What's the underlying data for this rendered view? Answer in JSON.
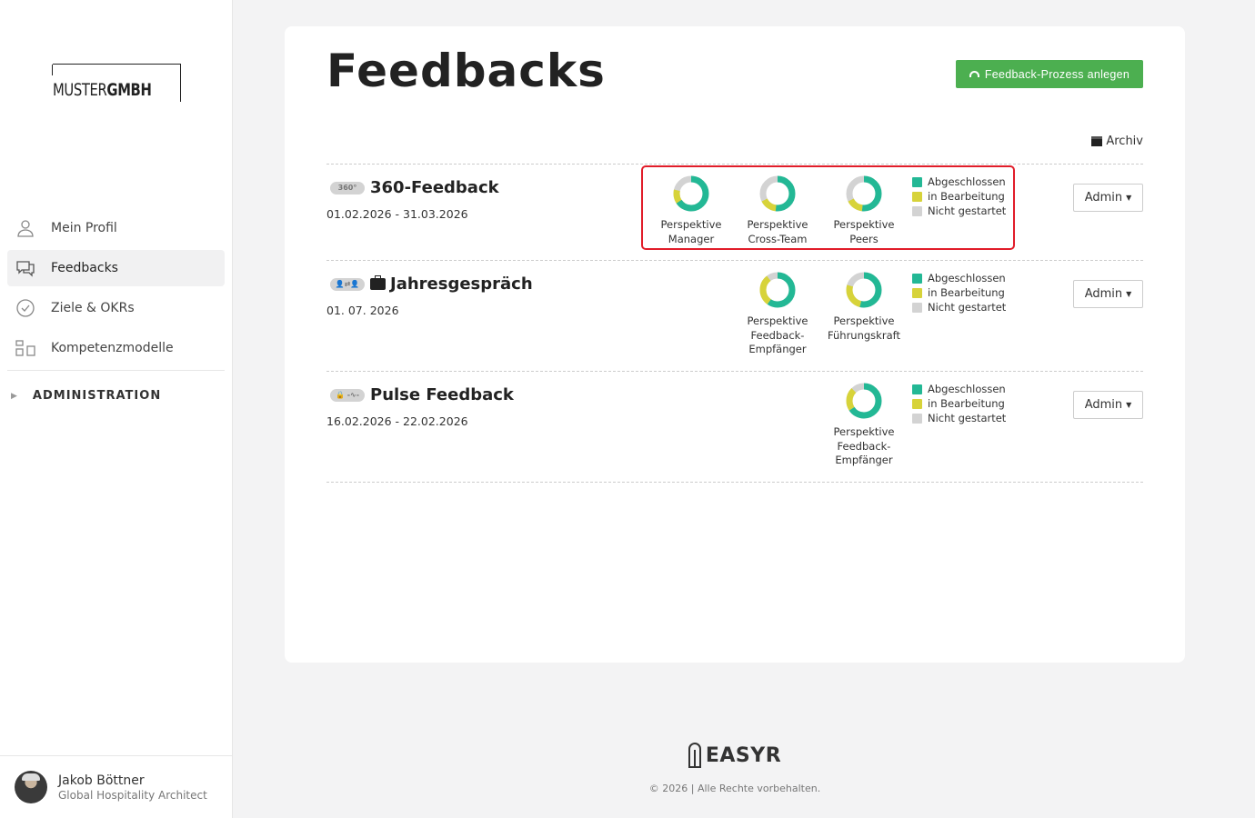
{
  "sidebar": {
    "logo": {
      "part1": "MUSTER",
      "part2": "GMBH"
    },
    "nav": [
      {
        "label": "Mein Profil",
        "icon": "user-icon"
      },
      {
        "label": "Feedbacks",
        "icon": "chat-icon"
      },
      {
        "label": "Ziele & OKRs",
        "icon": "check-circle-icon"
      },
      {
        "label": "Kompetenzmodelle",
        "icon": "model-icon"
      }
    ],
    "admin_label": "ADMINISTRATION",
    "user": {
      "name": "Jakob Böttner",
      "role": "Global Hospitality Architect"
    }
  },
  "main": {
    "title": "Feedbacks",
    "create_button": "Feedback-Prozess anlegen",
    "archive_label": "Archiv",
    "feedbacks": [
      {
        "title": "360-Feedback",
        "type_icon": "360°",
        "date": "01.02.2026 - 31.03.2026",
        "admin": "Admin",
        "perspectives": [
          {
            "label1": "Perspektive",
            "label2": "Manager",
            "label3": ""
          },
          {
            "label1": "Perspektive",
            "label2": "Cross-Team",
            "label3": ""
          },
          {
            "label1": "Perspektive",
            "label2": "Peers",
            "label3": ""
          }
        ]
      },
      {
        "title": "Jahresgespräch",
        "type_icon": "👤⇄👤",
        "date": "01. 07. 2026",
        "admin": "Admin",
        "perspectives": [
          {
            "label1": "Perspektive",
            "label2": "Feedback-",
            "label3": "Empfänger"
          },
          {
            "label1": "Perspektive",
            "label2": "Führungskraft",
            "label3": ""
          }
        ]
      },
      {
        "title": "Pulse Feedback",
        "type_icon": "🔒 -∿-",
        "date": "16.02.2026 - 22.02.2026",
        "admin": "Admin",
        "perspectives": [
          {
            "label1": "Perspektive",
            "label2": "Feedback-",
            "label3": "Empfänger"
          }
        ]
      }
    ],
    "legend": {
      "done": "Abgeschlossen",
      "in_progress": "in Bearbeitung",
      "not_started": "Nicht gestartet"
    }
  },
  "colors": {
    "done": "#23b895",
    "in_progress": "#d7d33a",
    "not_started": "#d3d3d3",
    "create_button": "#4caf50",
    "highlight": "#e11d2a"
  },
  "footer": {
    "brand": "EASYR",
    "copyright": "© 2026 | Alle Rechte vorbehalten."
  }
}
